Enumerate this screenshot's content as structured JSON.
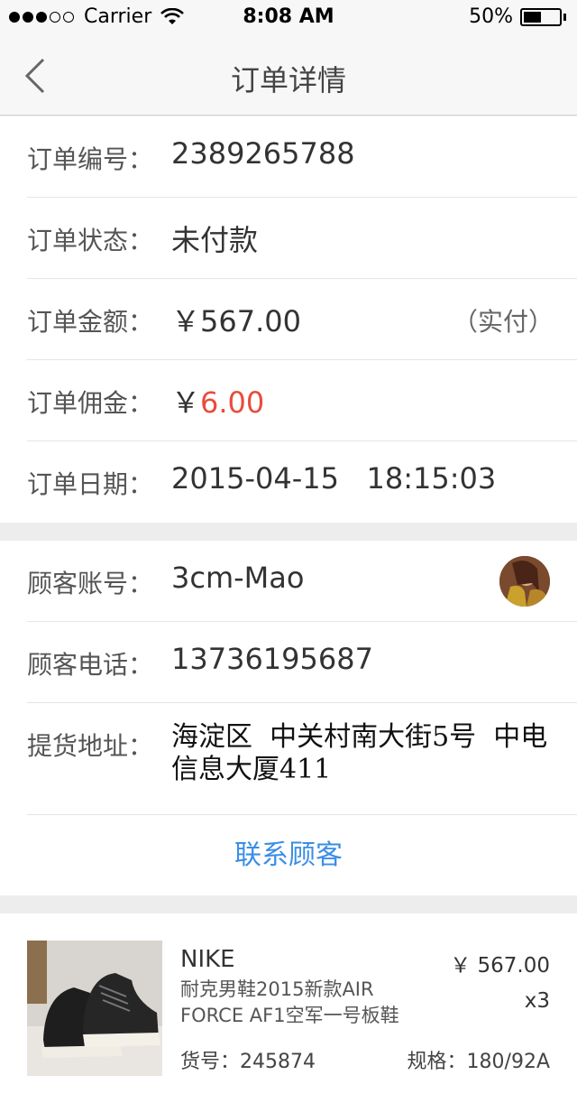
{
  "status_bar": {
    "carrier": "Carrier",
    "time": "8:08 AM",
    "battery_text": "50%",
    "battery_level": 0.5
  },
  "nav": {
    "title": "订单详情",
    "back_icon": "chevron-left-icon"
  },
  "order": {
    "number_label": "订单编号：",
    "number": "2389265788",
    "status_label": "订单状态：",
    "status": "未付款",
    "amount_label": "订单金额：",
    "amount_currency": "￥",
    "amount": "567.00",
    "amount_note": "（实付）",
    "commission_label": "订单佣金：",
    "commission_currency": "￥",
    "commission": "6.00",
    "date_label": "订单日期：",
    "date": "2015-04-15   18:15:03"
  },
  "customer": {
    "account_label": "顾客账号：",
    "account": "3cm-Mao",
    "phone_label": "顾客电话：",
    "phone": "13736195687",
    "address_label": "提货地址：",
    "address": "海淀区  中关村南大街5号  中电信息大厦411",
    "contact_label": "联系顾客"
  },
  "product": {
    "brand": "NIKE",
    "name": "耐克男鞋2015新款AIR FORCE AF1空军一号板鞋",
    "price": "￥ 567.00",
    "quantity": "x3",
    "sku": "货号：245874",
    "spec": "规格：180/92A"
  },
  "colors": {
    "accent_blue": "#3a8ee6",
    "commission_red": "#e84c3d"
  }
}
